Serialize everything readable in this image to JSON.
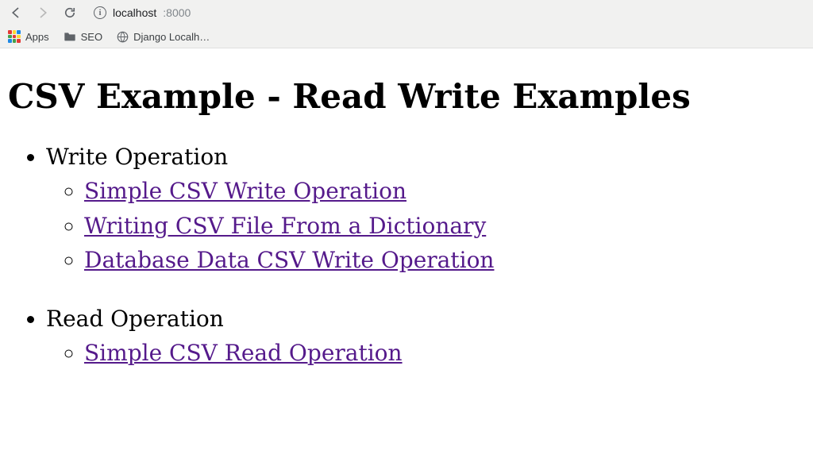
{
  "browser": {
    "url_host": "localhost",
    "url_port": ":8000",
    "bookmarks": {
      "apps": "Apps",
      "seo": "SEO",
      "django": "Django Localh…"
    }
  },
  "page": {
    "title": "CSV Example - Read Write Examples",
    "sections": [
      {
        "title": "Write Operation",
        "links": [
          "Simple CSV Write Operation",
          "Writing CSV File From a Dictionary",
          "Database Data CSV Write Operation"
        ]
      },
      {
        "title": "Read Operation",
        "links": [
          "Simple CSV Read Operation"
        ]
      }
    ]
  }
}
